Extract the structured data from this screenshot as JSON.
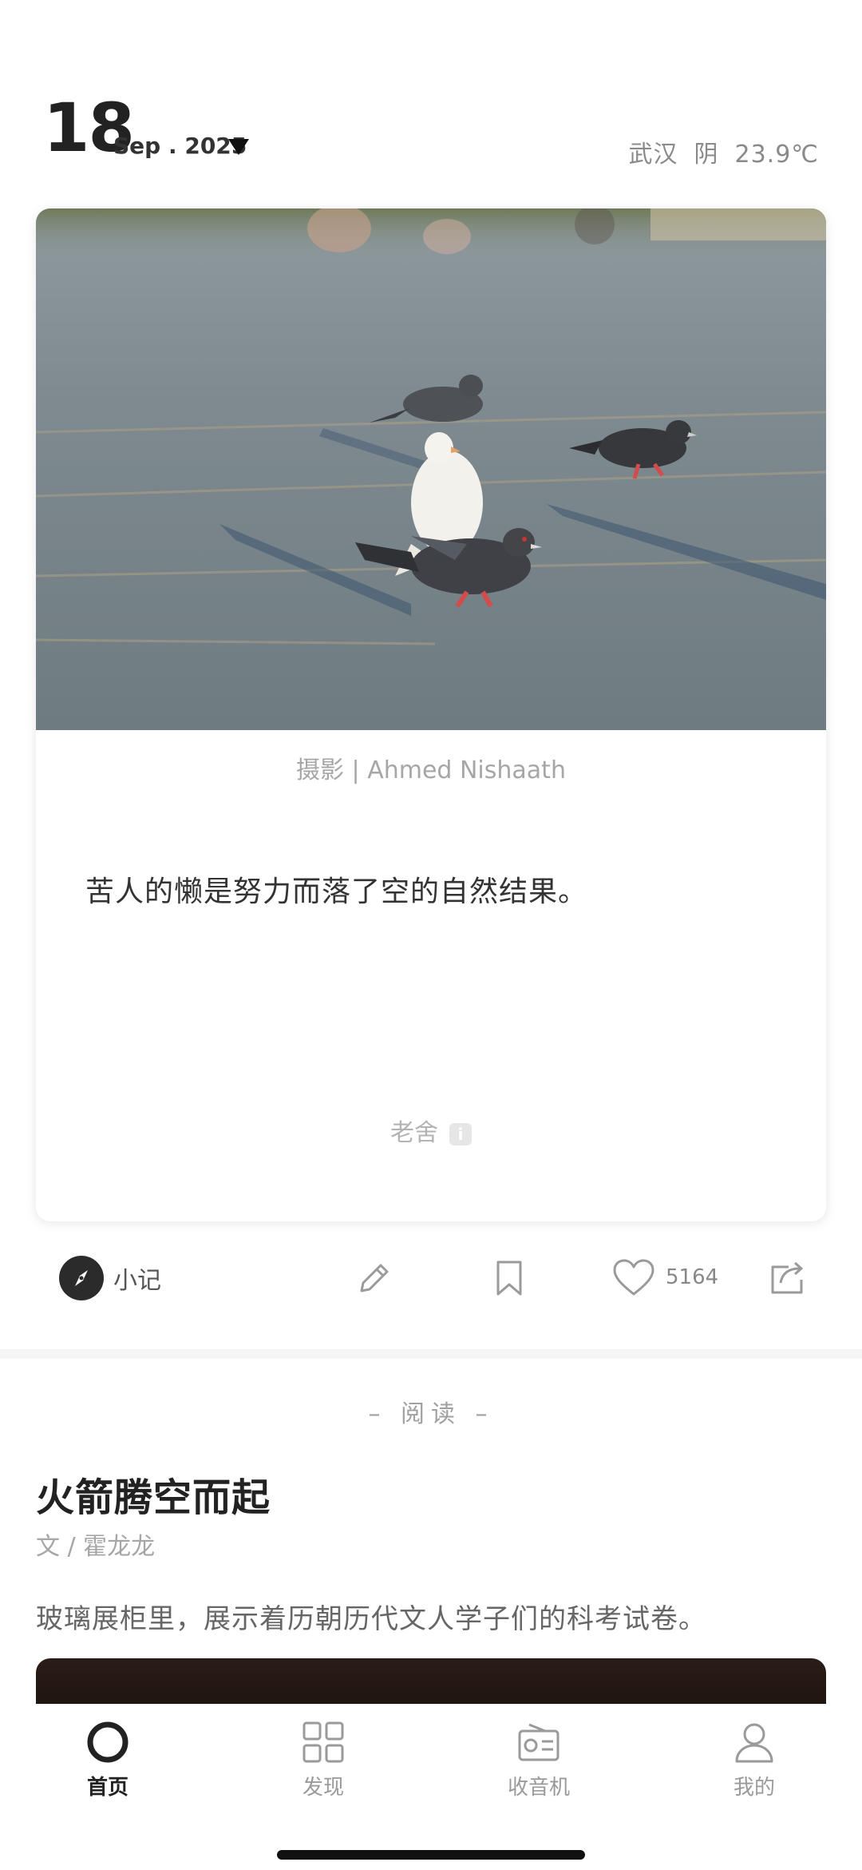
{
  "header": {
    "day": "18",
    "month_year": "Sep . 2025",
    "city": "武汉",
    "condition": "阴",
    "temperature": "23.9℃"
  },
  "card": {
    "photo_credit": "摄影 | Ahmed Nishaath",
    "quote": "苦人的懒是努力而落了空的自然结果。",
    "author": "老舍",
    "info_icon": "i"
  },
  "actions": {
    "note_label": "小记",
    "like_count": "5164",
    "icons": [
      "compass-icon",
      "pencil-icon",
      "bookmark-icon",
      "heart-icon",
      "share-icon"
    ]
  },
  "reading": {
    "section_label": "– 阅读 –",
    "title": "火箭腾空而起",
    "author": "文 / 霍龙龙",
    "excerpt": "玻璃展柜里，展示着历朝历代文人学子们的科考试卷。"
  },
  "tabbar": {
    "tabs": [
      {
        "label": "首页",
        "icon": "circle-home-icon",
        "active": true
      },
      {
        "label": "发现",
        "icon": "grid-icon",
        "active": false
      },
      {
        "label": "收音机",
        "icon": "radio-icon",
        "active": false
      },
      {
        "label": "我的",
        "icon": "person-icon",
        "active": false
      }
    ]
  }
}
